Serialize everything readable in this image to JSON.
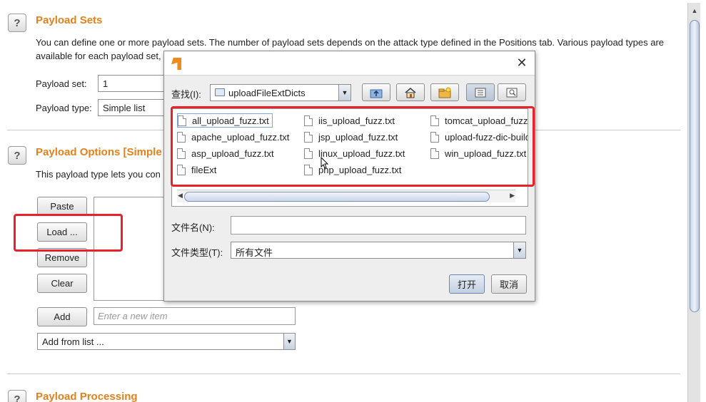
{
  "payload_sets": {
    "title": "Payload Sets",
    "help": "?",
    "desc_line1": "You can define one or more payload sets. The number of payload sets depends on the attack type defined in the Positions tab. Various payload types are",
    "desc_line2": "available for each payload set,",
    "set_label": "Payload set:",
    "set_value": "1",
    "type_label": "Payload type:",
    "type_value": "Simple list"
  },
  "payload_options": {
    "title": "Payload Options [Simple l",
    "help": "?",
    "desc": "This payload type lets you con",
    "buttons": {
      "paste": "Paste",
      "load": "Load ...",
      "remove": "Remove",
      "clear": "Clear",
      "add": "Add"
    },
    "new_item_placeholder": "Enter a new item",
    "add_from_list": "Add from list ..."
  },
  "payload_processing": {
    "title": "Payload Processing",
    "help": "?"
  },
  "dialog": {
    "close": "✕",
    "look_in_label": "查找(I):",
    "look_in_value": "uploadFileExtDicts",
    "files": [
      "all_upload_fuzz.txt",
      "apache_upload_fuzz.txt",
      "asp_upload_fuzz.txt",
      "fileExt",
      "iis_upload_fuzz.txt",
      "jsp_upload_fuzz.txt",
      "linux_upload_fuzz.txt",
      "php_upload_fuzz.txt",
      "tomcat_upload_fuzz",
      "upload-fuzz-dic-build",
      "win_upload_fuzz.txt"
    ],
    "filename_label": "文件名(N):",
    "filename_value": "",
    "filetype_label": "文件类型(T):",
    "filetype_value": "所有文件",
    "open_button": "打开",
    "cancel_button": "取消"
  },
  "colors": {
    "section_title": "#e3811c",
    "highlight": "#e8222a"
  },
  "icons": [
    "help-icon",
    "app-icon",
    "close-icon",
    "folder-icon",
    "up-folder-icon",
    "home-icon",
    "new-folder-icon",
    "list-view-icon",
    "details-view-icon",
    "file-icon",
    "chevron-down-icon"
  ]
}
